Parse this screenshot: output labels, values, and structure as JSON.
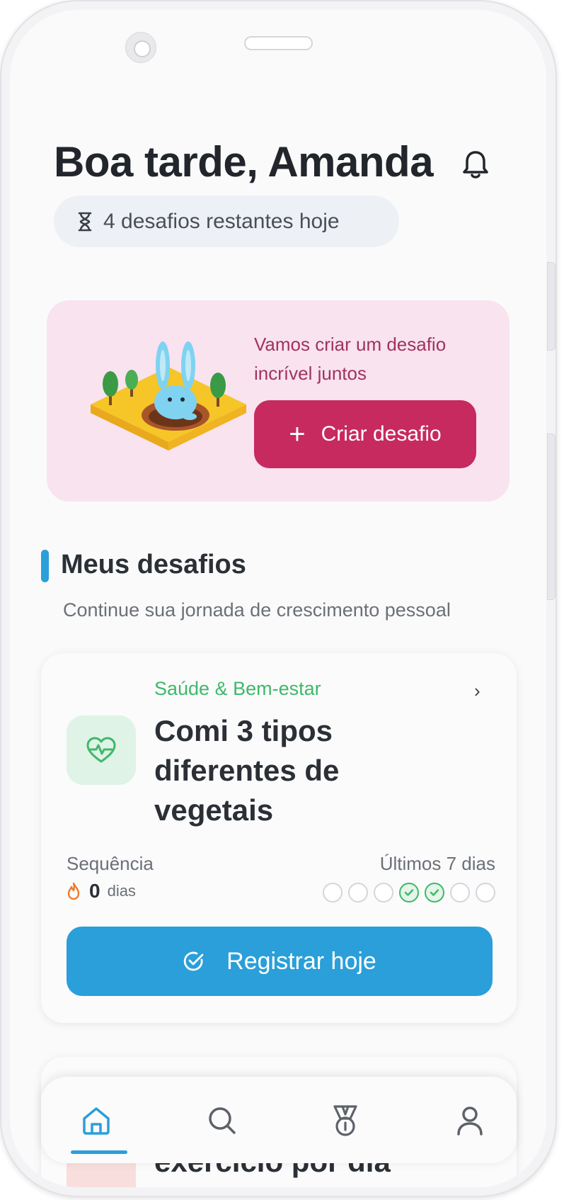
{
  "header": {
    "greeting": "Boa tarde, Amanda",
    "notifications_icon": "bell-icon",
    "remaining_icon": "hourglass-icon",
    "remaining_text": "4 desafios restantes hoje"
  },
  "banner": {
    "message": "Vamos criar um desafio incrível juntos",
    "create_button": "Criar desafio",
    "create_icon": "plus-icon",
    "illustration": "bunny-in-hole-illustration"
  },
  "section": {
    "title": "Meus desafios",
    "subtitle": "Continue sua jornada de crescimento pessoal"
  },
  "challenges": [
    {
      "category": "Saúde & Bem-estar",
      "category_color": "#3fb86a",
      "icon": "heart-pulse-icon",
      "title": "Comi 3 tipos diferentes de vegetais",
      "streak_label": "Sequência",
      "streak_value": "0",
      "streak_unit": "dias",
      "last_days_label": "Últimos 7 dias",
      "last_7_days": [
        false,
        false,
        false,
        true,
        true,
        false,
        false
      ],
      "register_button": "Registrar hoje"
    },
    {
      "title": "exercício por dia"
    }
  ],
  "tabbar": {
    "tabs": [
      {
        "icon": "home-icon",
        "active": true
      },
      {
        "icon": "search-icon",
        "active": false
      },
      {
        "icon": "medal-icon",
        "active": false
      },
      {
        "icon": "user-icon",
        "active": false
      }
    ]
  },
  "colors": {
    "primary": "#2a9fd9",
    "accent": "#c72a5e",
    "banner_bg": "#f8e3ef",
    "success": "#3fb86a"
  }
}
